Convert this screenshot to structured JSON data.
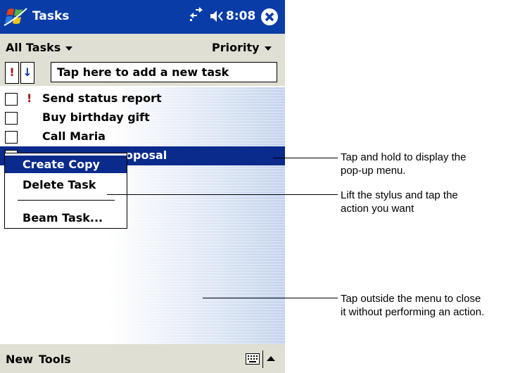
{
  "titlebar": {
    "app_title": "Tasks",
    "time": "8:08",
    "icons": [
      "windows-start-icon",
      "connectivity-icon",
      "speaker-icon",
      "close-icon"
    ]
  },
  "menubar": {
    "filter_label": "All Tasks",
    "sort_label": "Priority"
  },
  "entrybar": {
    "priority_button": "!",
    "sort_button": "↓",
    "new_task_placeholder": "Tap here to add a new task"
  },
  "tasks": [
    {
      "label": "Send status report",
      "high_priority": true,
      "priority_mark": "!",
      "checked": false
    },
    {
      "label": "Buy birthday gift",
      "high_priority": false,
      "checked": false
    },
    {
      "label": "Call Maria",
      "high_priority": false,
      "checked": false
    },
    {
      "label": "oposal",
      "high_priority": false,
      "checked": false,
      "selected": true
    }
  ],
  "popup_menu": {
    "items": [
      "Create Copy",
      "Delete Task",
      "Beam Task..."
    ],
    "highlighted": "Create Copy"
  },
  "bottombar": {
    "new_label": "New",
    "tools_label": "Tools"
  },
  "callouts": {
    "hold": {
      "line1": "Tap and hold to display the",
      "line2": "pop-up menu."
    },
    "lift": {
      "line1": "Lift the stylus and tap the",
      "line2": "action you want"
    },
    "outside": {
      "line1": "Tap outside the menu to close",
      "line2": "it without performing an action."
    }
  },
  "colors": {
    "titlebar": "#0a3ca8",
    "selection": "#0a2a8c",
    "toolbar": "#e0dfd3",
    "priority_mark": "#9b1010"
  }
}
